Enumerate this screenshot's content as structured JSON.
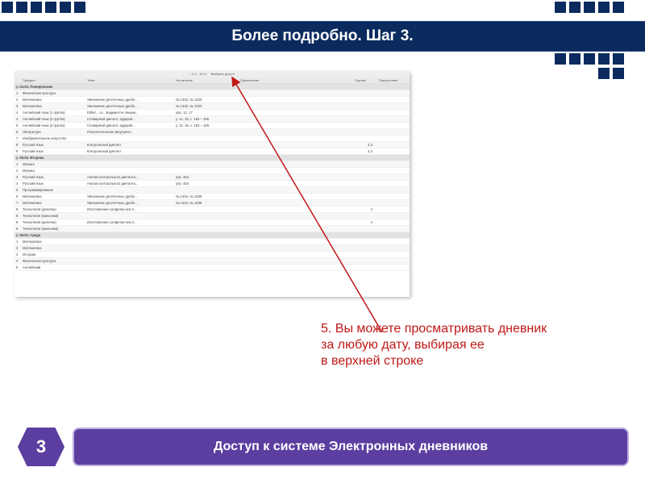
{
  "title": "Более подробно. Шаг 3.",
  "annotation": {
    "line1": "5. Вы можете просматривать дневник",
    "line2": "за любую дату, выбирая ее",
    "line3": " в верхней строке"
  },
  "footer": {
    "badge": "3",
    "text": "Доступ к системе Электронных дневников"
  },
  "shot": {
    "datebar_left": "‹   4.3 - 10.3   ›",
    "datebar_right": "Выбрать дату ▾",
    "cols": {
      "subject": "Предмет",
      "topic": "Тема",
      "home": "На занятие",
      "extra": "Примечание",
      "mark": "Оценка",
      "att": "Присутствие"
    },
    "days": [
      {
        "label": "04.03. Понедельник",
        "rows": [
          {
            "n": "1",
            "subj": "Физическая культура",
            "topic": "",
            "home": "",
            "mark": "",
            "att": ""
          },
          {
            "n": "2",
            "subj": "Математика",
            "topic": "Умножение десятичных дробе...",
            "home": "№ 1332, № 1333",
            "mark": "",
            "att": ""
          },
          {
            "n": "3",
            "subj": "Математика",
            "topic": "Умножение десятичных дробе...",
            "home": "№ 1332, № 1333",
            "mark": "",
            "att": ""
          },
          {
            "n": "4",
            "subj": "Английский язык (1 группа)",
            "topic": "Either... or... Бадминтон лекции...",
            "home": "упр. 12, 17",
            "mark": "",
            "att": ""
          },
          {
            "n": "4",
            "subj": "Английский язык (2 группа)",
            "topic": "Словарный диктант, аудиров...",
            "home": "у. 12, 15, с. 163 – 165",
            "mark": "",
            "att": ""
          },
          {
            "n": "5",
            "subj": "Английский язык (2 группа)",
            "topic": "Словарный диктант, аудиров...",
            "home": "у. 12, 15, с. 163 – 165",
            "mark": "",
            "att": ""
          },
          {
            "n": "6",
            "subj": "Литература",
            "topic": "Психологическая (внутренн...",
            "home": "",
            "mark": "",
            "att": ""
          },
          {
            "n": "7",
            "subj": "Изобразительное искусство",
            "topic": "",
            "home": "",
            "mark": "",
            "att": ""
          },
          {
            "n": "8",
            "subj": "Русский язык",
            "topic": "Контрольный диктант",
            "home": "",
            "mark": "4,3",
            "att": ""
          },
          {
            "n": "9",
            "subj": "Русский язык",
            "topic": "Контрольный диктант",
            "home": "",
            "mark": "4,4",
            "att": ""
          }
        ]
      },
      {
        "label": "05.03. Вторник",
        "rows": [
          {
            "n": "1",
            "subj": "Музыка",
            "topic": "",
            "home": "",
            "mark": "",
            "att": ""
          },
          {
            "n": "2",
            "subj": "Музыка",
            "topic": "",
            "home": "",
            "mark": "",
            "att": ""
          },
          {
            "n": "3",
            "subj": "Русский язык",
            "topic": "Анализ контрольного диктанта...",
            "home": "упр. 454",
            "mark": "",
            "att": ""
          },
          {
            "n": "4",
            "subj": "Русский язык",
            "topic": "Анализ контрольного диктанта...",
            "home": "упр. 454",
            "mark": "",
            "att": ""
          },
          {
            "n": "5",
            "subj": "Программирование",
            "topic": "",
            "home": "",
            "mark": "",
            "att": ""
          },
          {
            "n": "6",
            "subj": "Математика",
            "topic": "Умножение десятичных дробе...",
            "home": "№ 1334, № 1335",
            "mark": "",
            "att": ""
          },
          {
            "n": "7",
            "subj": "Математика",
            "topic": "Умножение десятичных дробе...",
            "home": "№ 1334, № 1335",
            "mark": "",
            "att": ""
          },
          {
            "n": "8",
            "subj": "Технология (девочки)",
            "topic": "Изготовление салфетки или п...",
            "home": "",
            "mark": "4",
            "att": ""
          },
          {
            "n": "8",
            "subj": "Технология (мальчики)",
            "topic": "",
            "home": "",
            "mark": "",
            "att": ""
          },
          {
            "n": "9",
            "subj": "Технология (девочки)",
            "topic": "Изготовление салфетки или п...",
            "home": "",
            "mark": "4",
            "att": ""
          },
          {
            "n": "9",
            "subj": "Технология (мальчики)",
            "topic": "",
            "home": "",
            "mark": "",
            "att": ""
          }
        ]
      },
      {
        "label": "06.03. Среда",
        "rows": [
          {
            "n": "1",
            "subj": "Математика",
            "topic": "",
            "home": "",
            "mark": "",
            "att": ""
          },
          {
            "n": "2",
            "subj": "Математика",
            "topic": "",
            "home": "",
            "mark": "",
            "att": ""
          },
          {
            "n": "3",
            "subj": "История",
            "topic": "",
            "home": "",
            "mark": "",
            "att": ""
          },
          {
            "n": "4",
            "subj": "Физическая культура",
            "topic": "",
            "home": "",
            "mark": "",
            "att": ""
          },
          {
            "n": "5",
            "subj": "Английский",
            "topic": "",
            "home": "",
            "mark": "",
            "att": ""
          }
        ]
      }
    ]
  }
}
